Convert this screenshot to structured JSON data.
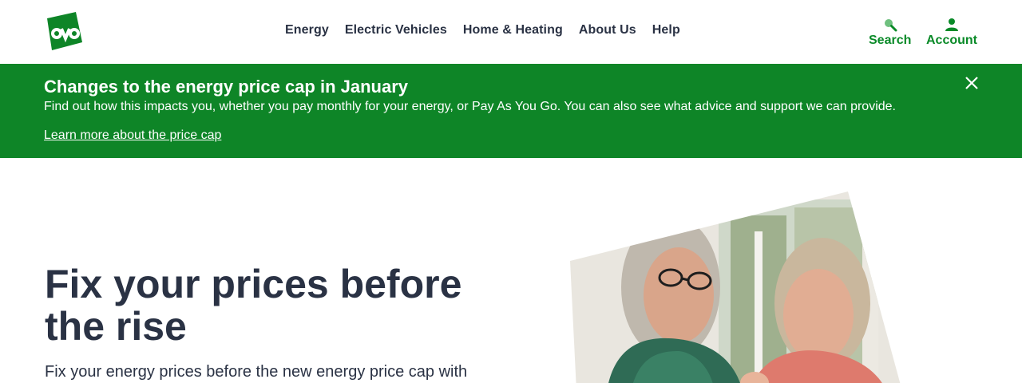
{
  "header": {
    "logo_text": "ovo",
    "nav": [
      "Energy",
      "Electric Vehicles",
      "Home & Heating",
      "About Us",
      "Help"
    ],
    "search_label": "Search",
    "account_label": "Account"
  },
  "banner": {
    "title": "Changes to the energy price cap in January",
    "text": "Find out how this impacts you, whether you pay monthly for your energy, or Pay As You Go. You can also see what advice and support we can provide.",
    "link": "Learn more about the price cap"
  },
  "hero": {
    "title": "Fix your prices before the rise",
    "subtitle": "Fix your energy prices before the new energy price cap with"
  },
  "colors": {
    "brand_green": "#0e8527",
    "text_navy": "#2a3244",
    "accent_green": "#0a8a28"
  }
}
